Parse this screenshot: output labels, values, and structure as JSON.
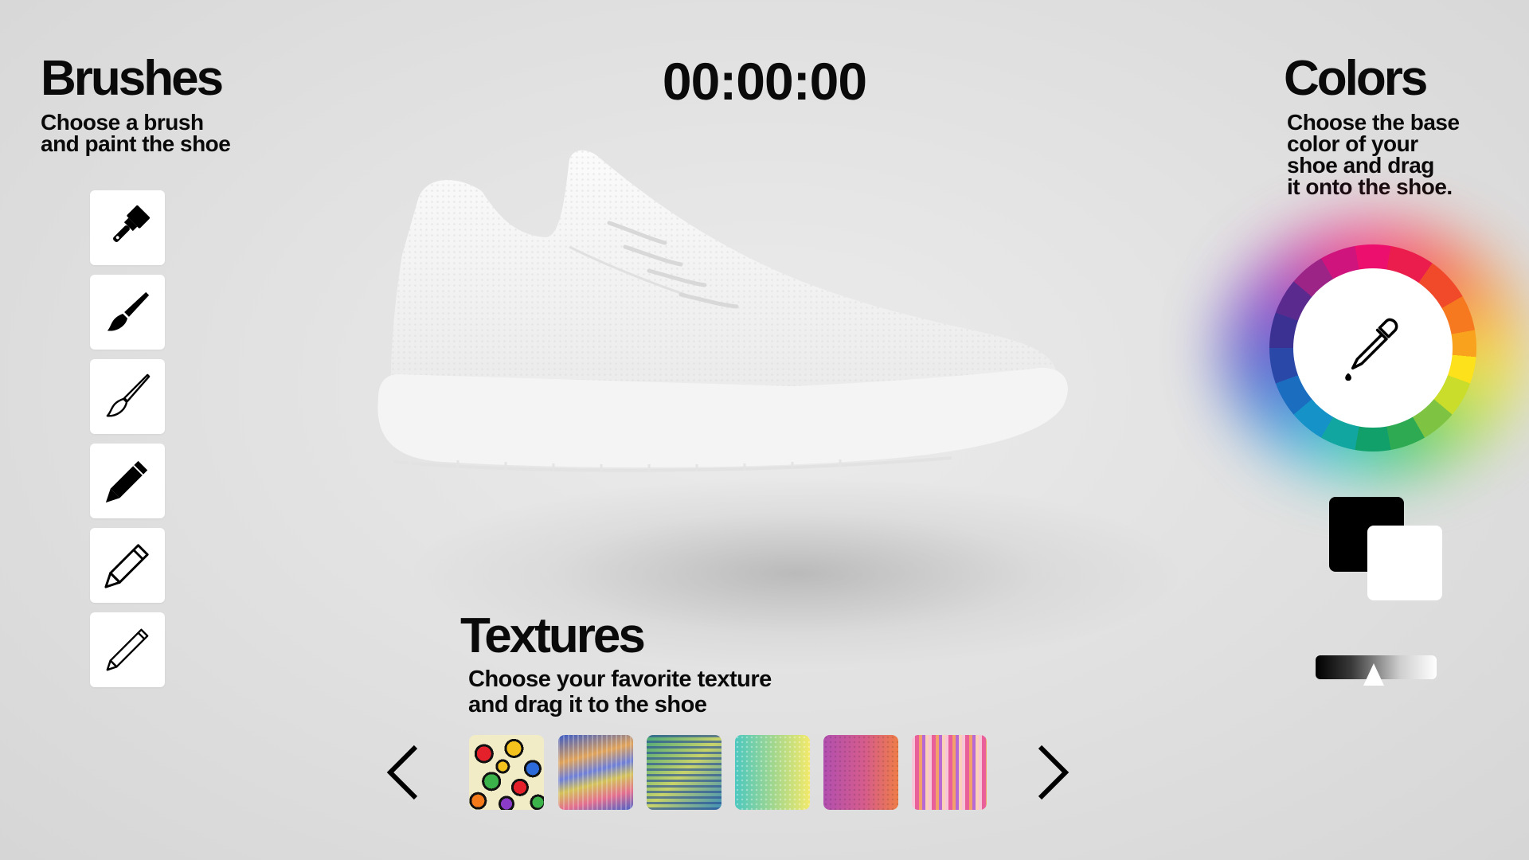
{
  "timer": "00:00:00",
  "brushes": {
    "title": "Brushes",
    "subtitle": "Choose a brush\nand paint the shoe",
    "tools": [
      {
        "icon": "paint-roller-brush-icon"
      },
      {
        "icon": "paint-brush-icon"
      },
      {
        "icon": "fine-brush-icon"
      },
      {
        "icon": "marker-icon"
      },
      {
        "icon": "pencil-icon"
      },
      {
        "icon": "thin-pencil-icon"
      }
    ]
  },
  "colors": {
    "title": "Colors",
    "subtitle": "Choose the base\ncolor of your\nshoe and drag\nit onto the shoe.",
    "picker_icon": "eyedropper-icon",
    "primary": "#000000",
    "secondary": "#ffffff",
    "shade_slider_value": 0.5
  },
  "textures": {
    "title": "Textures",
    "subtitle": "Choose your favorite texture\nand drag it to the shoe",
    "prev_icon": "chevron-left-icon",
    "next_icon": "chevron-right-icon",
    "items": [
      {
        "name": "leopard-multicolor"
      },
      {
        "name": "wavy-stripes"
      },
      {
        "name": "green-lines"
      },
      {
        "name": "teal-yellow-gradient"
      },
      {
        "name": "purple-orange-gradient"
      },
      {
        "name": "pink-stripes"
      }
    ]
  }
}
